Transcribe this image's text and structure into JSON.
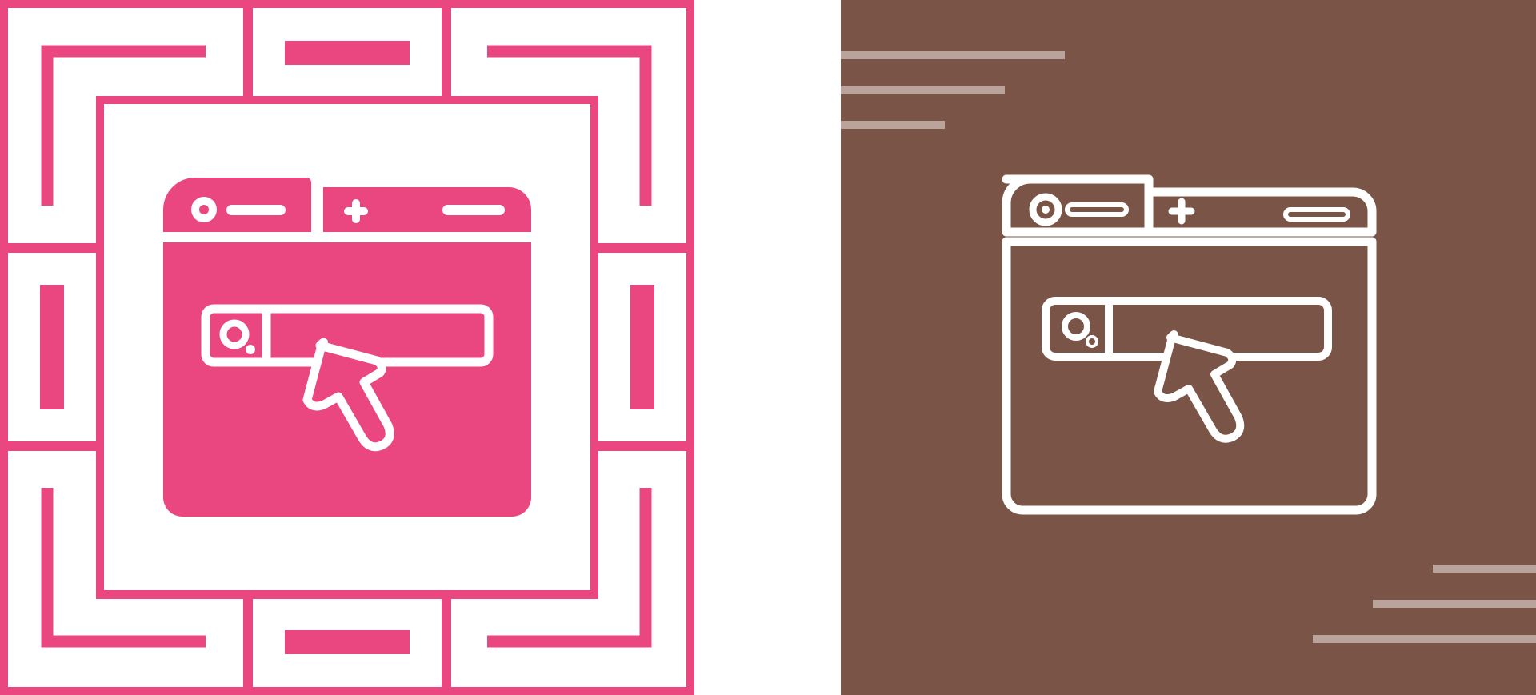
{
  "colors": {
    "accent": "#ea4780",
    "background": "#ffffff",
    "brown": "#7a5547",
    "stripe": "#b9a39a",
    "line": "#ffffff"
  },
  "icons": {
    "left": "browser-search-cursor-glyph-icon",
    "right": "browser-search-cursor-line-icon"
  }
}
